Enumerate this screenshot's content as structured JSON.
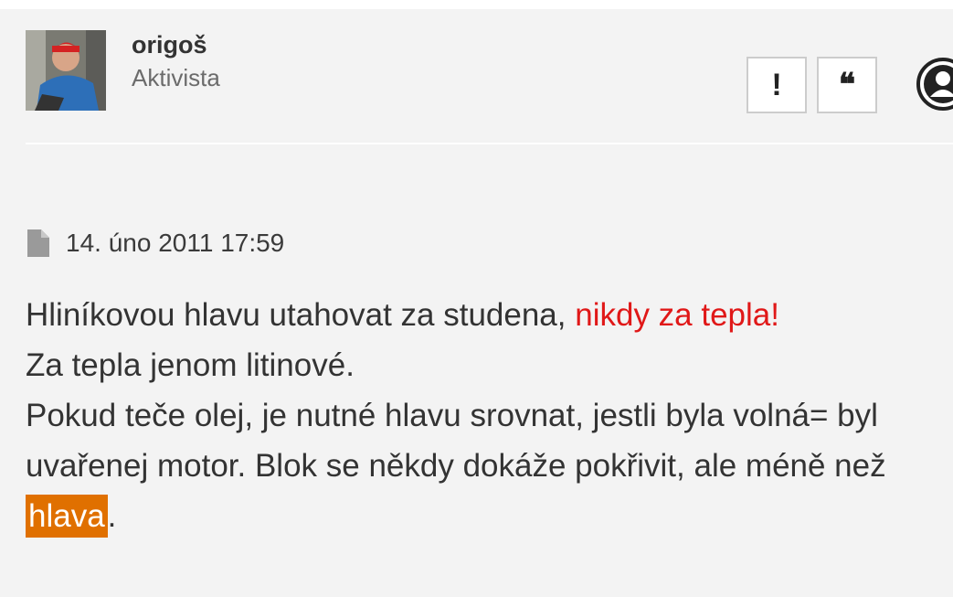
{
  "author": {
    "name": "origoš",
    "rank": "Aktivista"
  },
  "actions": {
    "report_label": "!",
    "quote_label": "❝"
  },
  "post": {
    "date": "14. úno 2011 17:59",
    "line1_plain": "Hliníkovou hlavu utahovat za studena, ",
    "line1_red": "nikdy za tepla!",
    "line2": "Za tepla jenom litinové.",
    "line3": "Pokud teče olej, je nutné hlavu srovnat, jestli byla volná= byl uvařenej motor. Blok se někdy dokáže pokřivit, ale méně než ",
    "highlight": "hlava",
    "tail": "."
  },
  "colors": {
    "background": "#f3f3f3",
    "emphasis_red": "#e01818",
    "highlight_orange": "#e07000"
  },
  "icons": [
    "document-icon",
    "exclamation-icon",
    "quote-icon",
    "user-icon"
  ]
}
